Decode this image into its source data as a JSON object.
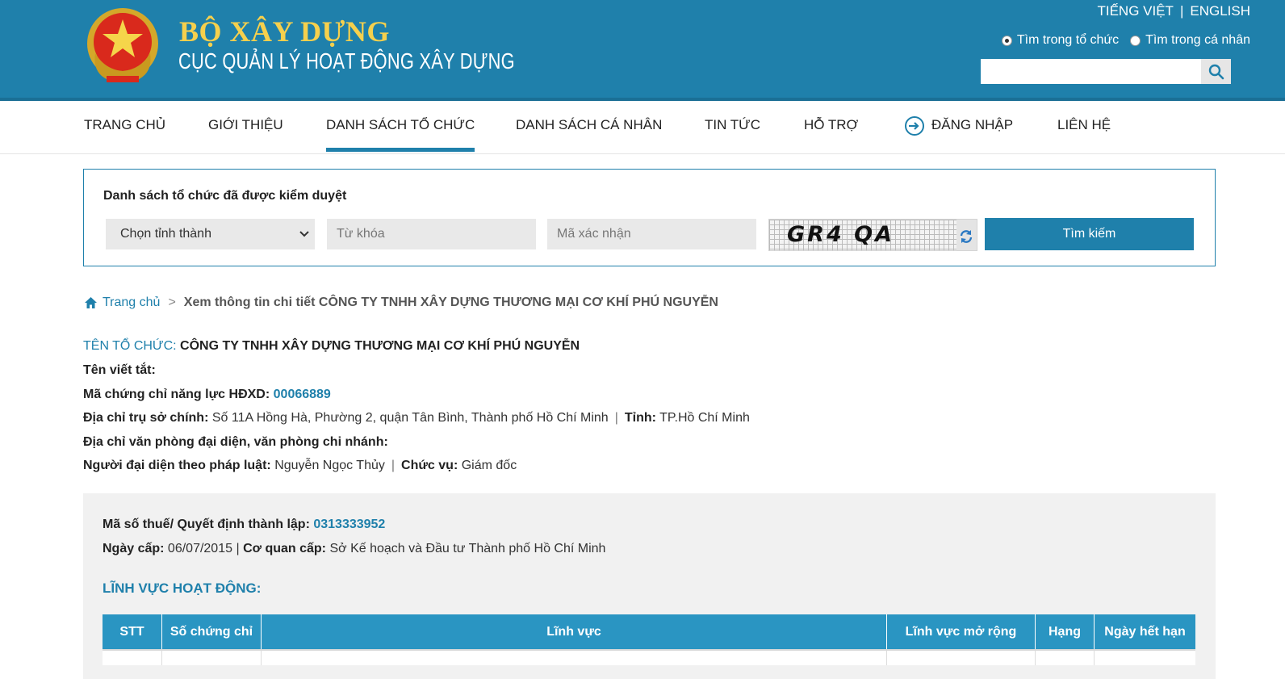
{
  "header": {
    "title": "BỘ XÂY DỰNG",
    "subtitle": "CỤC QUẢN LÝ HOẠT ĐỘNG XÂY DỰNG",
    "lang_vi": "TIẾNG VIỆT",
    "lang_sep": "|",
    "lang_en": "ENGLISH",
    "scope_org": "Tìm trong tổ chức",
    "scope_person": "Tìm trong cá nhân",
    "search_value": ""
  },
  "nav": {
    "home": "TRANG CHỦ",
    "about": "GIỚI THIỆU",
    "org_list": "DANH SÁCH TỔ CHỨC",
    "person_list": "DANH SÁCH CÁ NHÂN",
    "news": "TIN TỨC",
    "support": "HỖ TRỢ",
    "login": "ĐĂNG NHẬP",
    "contact": "LIÊN HỆ"
  },
  "filter": {
    "title": "Danh sách tổ chức đã được kiểm duyệt",
    "province_selected": "Chọn tỉnh thành",
    "keyword_placeholder": "Từ khóa",
    "captcha_placeholder": "Mã xác nhận",
    "captcha_text": "GR4 QA",
    "search_button": "Tìm kiếm"
  },
  "breadcrumb": {
    "home": "Trang chủ",
    "arrow": ">",
    "current": "Xem thông tin chi tiết CÔNG TY TNHH XÂY DỰNG THƯƠNG MẠI CƠ KHÍ PHÚ NGUYỄN"
  },
  "org": {
    "name_label": "TÊN TỔ CHỨC:",
    "name": "CÔNG TY TNHH XÂY DỰNG THƯƠNG MẠI CƠ KHÍ PHÚ NGUYỄN",
    "short_name_label": "Tên viết tắt:",
    "cert_label": "Mã chứng chỉ năng lực HĐXD:",
    "cert": "00066889",
    "address_label": "Địa chỉ trụ sở chính:",
    "address": "Số 11A Hồng Hà, Phường 2, quận Tân Bình, Thành phố Hồ Chí Minh",
    "sep": "|",
    "province_label": "Tỉnh:",
    "province": "TP.Hồ Chí Minh",
    "branch_label": "Địa chỉ văn phòng đại diện, văn phòng chi nhánh:",
    "rep_label": "Người đại diện theo pháp luật:",
    "rep": "Nguyễn Ngọc Thủy",
    "position_label": "Chức vụ:",
    "position": "Giám đốc"
  },
  "details": {
    "tax_label": "Mã số thuế/ Quyết định thành lập:",
    "tax": "0313333952",
    "issue_date_label": "Ngày cấp:",
    "issue_date": "06/07/2015",
    "sep": "|",
    "issuer_label": "Cơ quan cấp:",
    "issuer": "Sở Kế hoạch và Đầu tư Thành phố Hồ Chí Minh",
    "section_title": "LĨNH VỰC HOẠT ĐỘNG:"
  },
  "table": {
    "headers": [
      "STT",
      "Số chứng chỉ",
      "Lĩnh vực",
      "Lĩnh vực mở rộng",
      "Hạng",
      "Ngày hết hạn"
    ]
  },
  "colors": {
    "primary": "#1f80ab",
    "header_bg": "#1f80ab",
    "title_gold": "#f6d04d",
    "table_header": "#2a95c2"
  }
}
